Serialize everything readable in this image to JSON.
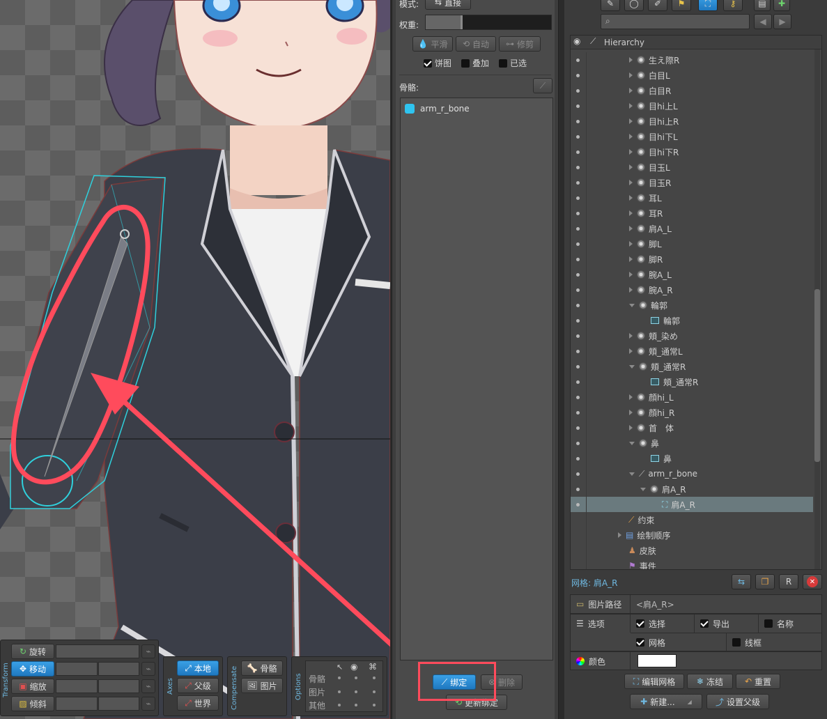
{
  "mid": {
    "mode_label": "模式:",
    "mode_value": "直接",
    "weight_label": "权重:",
    "smooth": "平滑",
    "auto": "自动",
    "prune": "修剪",
    "pie_chart": "饼图",
    "overlay": "叠加",
    "selected": "已选",
    "bones_label": "骨骼:",
    "bone_item": "arm_r_bone",
    "bone_color": "#2fc4f0",
    "bind": "绑定",
    "delete": "删除",
    "update_bind": "更新绑定"
  },
  "transform": {
    "title": "Transform",
    "rotate": "旋转",
    "move": "移动",
    "scale": "缩放",
    "shear": "倾斜"
  },
  "axes": {
    "title": "Axes",
    "local": "本地",
    "parent": "父级",
    "world": "世界"
  },
  "compensate": {
    "title": "Compensate",
    "bones": "骨骼",
    "images": "图片"
  },
  "options": {
    "title": "Options",
    "rows": [
      "骨骼",
      "图片",
      "其他"
    ]
  },
  "hierarchy": {
    "title": "Hierarchy",
    "items": [
      {
        "label": "生え際R",
        "type": "bone",
        "depth": 2,
        "expand": "right"
      },
      {
        "label": "白目L",
        "type": "bone",
        "depth": 2,
        "expand": "right"
      },
      {
        "label": "白目R",
        "type": "bone",
        "depth": 2,
        "expand": "right"
      },
      {
        "label": "目hi上L",
        "type": "bone",
        "depth": 2,
        "expand": "right"
      },
      {
        "label": "目hi上R",
        "type": "bone",
        "depth": 2,
        "expand": "right"
      },
      {
        "label": "目hi下L",
        "type": "bone",
        "depth": 2,
        "expand": "right"
      },
      {
        "label": "目hi下R",
        "type": "bone",
        "depth": 2,
        "expand": "right"
      },
      {
        "label": "目玉L",
        "type": "bone",
        "depth": 2,
        "expand": "right"
      },
      {
        "label": "目玉R",
        "type": "bone",
        "depth": 2,
        "expand": "right"
      },
      {
        "label": "耳L",
        "type": "bone",
        "depth": 2,
        "expand": "right"
      },
      {
        "label": "耳R",
        "type": "bone",
        "depth": 2,
        "expand": "right"
      },
      {
        "label": "肩A_L",
        "type": "bone",
        "depth": 2,
        "expand": "right"
      },
      {
        "label": "脚L",
        "type": "bone",
        "depth": 2,
        "expand": "right"
      },
      {
        "label": "脚R",
        "type": "bone",
        "depth": 2,
        "expand": "right"
      },
      {
        "label": "腕A_L",
        "type": "bone",
        "depth": 2,
        "expand": "right"
      },
      {
        "label": "腕A_R",
        "type": "bone",
        "depth": 2,
        "expand": "right"
      },
      {
        "label": "輪郭",
        "type": "bone",
        "depth": 2,
        "expand": "down"
      },
      {
        "label": "輪郭",
        "type": "mesh",
        "depth": 3,
        "expand": "none"
      },
      {
        "label": "頬_染め",
        "type": "bone",
        "depth": 2,
        "expand": "right"
      },
      {
        "label": "頬_通常L",
        "type": "bone",
        "depth": 2,
        "expand": "right"
      },
      {
        "label": "頬_通常R",
        "type": "bone",
        "depth": 2,
        "expand": "down"
      },
      {
        "label": "頬_通常R",
        "type": "mesh",
        "depth": 3,
        "expand": "none"
      },
      {
        "label": "顔hi_L",
        "type": "bone",
        "depth": 2,
        "expand": "right"
      },
      {
        "label": "顔hi_R",
        "type": "bone",
        "depth": 2,
        "expand": "right"
      },
      {
        "label": "首　体",
        "type": "bone",
        "depth": 2,
        "expand": "right"
      },
      {
        "label": "鼻",
        "type": "bone",
        "depth": 2,
        "expand": "down"
      },
      {
        "label": "鼻",
        "type": "mesh",
        "depth": 3,
        "expand": "none"
      },
      {
        "label": "arm_r_bone",
        "type": "bonebranch",
        "depth": 2,
        "expand": "down"
      },
      {
        "label": "肩A_R",
        "type": "bone",
        "depth": 3,
        "expand": "down"
      },
      {
        "label": "肩A_R",
        "type": "meshsel",
        "depth": 4,
        "expand": "none"
      },
      {
        "label": "约束",
        "type": "constraint",
        "depth": 1,
        "expand": "none"
      },
      {
        "label": "绘制顺序",
        "type": "draw",
        "depth": 0,
        "expand": "right"
      },
      {
        "label": "皮肤",
        "type": "skin",
        "depth": 1,
        "expand": "none"
      },
      {
        "label": "事件",
        "type": "event",
        "depth": 1,
        "expand": "none"
      }
    ]
  },
  "props": {
    "title": "网格: 肩A_R",
    "image_path_label": "图片路径",
    "image_path_value": "<肩A_R>",
    "options_label": "选项",
    "select": "选择",
    "export": "导出",
    "name": "名称",
    "mesh": "网格",
    "wireframe": "线框",
    "color_label": "颜色",
    "color_value": "#ffffff",
    "edit_mesh": "编辑网格",
    "freeze": "冻结",
    "reset": "重置",
    "new": "新建...",
    "set_parent": "设置父级"
  }
}
